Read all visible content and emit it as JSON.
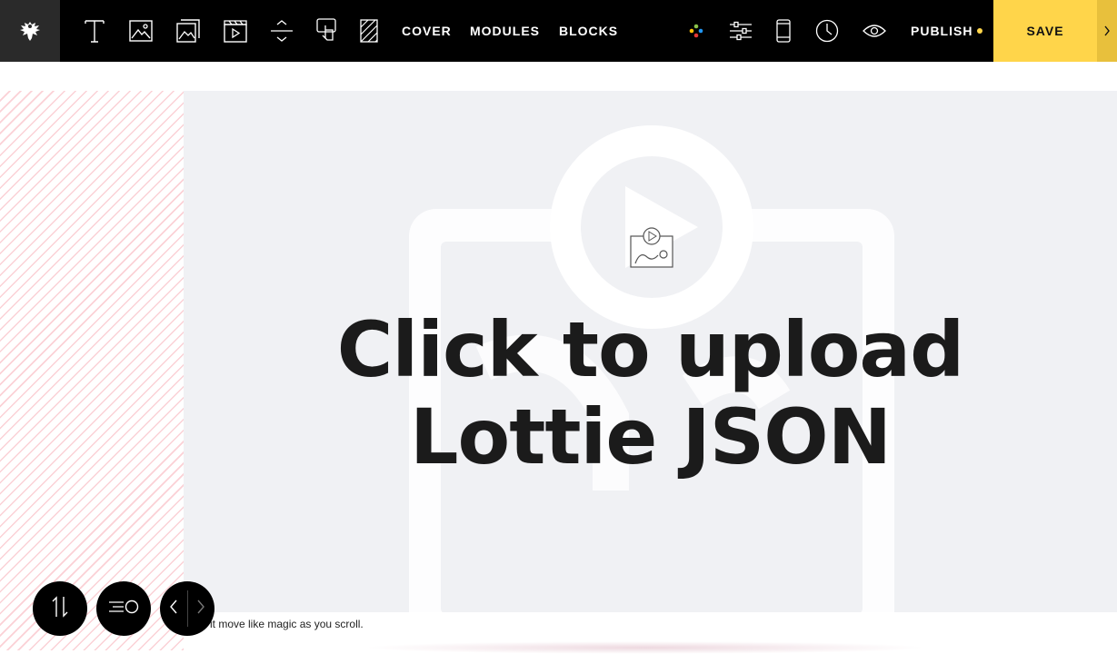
{
  "toolbar": {
    "logo_icon": "eagle-logo-icon",
    "tools": [
      {
        "name": "text-tool-icon"
      },
      {
        "name": "image-tool-icon"
      },
      {
        "name": "gallery-tool-icon"
      },
      {
        "name": "video-tool-icon"
      },
      {
        "name": "spacer-tool-icon"
      },
      {
        "name": "interactive-tool-icon"
      },
      {
        "name": "pattern-tool-icon"
      }
    ],
    "nav": {
      "cover": "COVER",
      "modules": "MODULES",
      "blocks": "BLOCKS"
    },
    "right_icons": [
      "colors-icon",
      "settings-sliders-icon",
      "mobile-preview-icon",
      "history-clock-icon",
      "preview-eye-icon"
    ],
    "publish_label": "PUBLISH",
    "save_label": "SAVE",
    "accent_color": "#ffd54a"
  },
  "stage": {
    "upload_line1": "Click to upload",
    "upload_line2": "Lottie JSON",
    "placeholder_icon": "lottie-animation-icon"
  },
  "caption": {
    "text": "ch it move like magic as you scroll."
  },
  "floating_controls": {
    "reorder_icon": "reorder-arrows-icon",
    "motion_icon": "motion-speed-icon",
    "prev_icon": "chevron-left-icon",
    "next_icon": "chevron-right-icon"
  }
}
